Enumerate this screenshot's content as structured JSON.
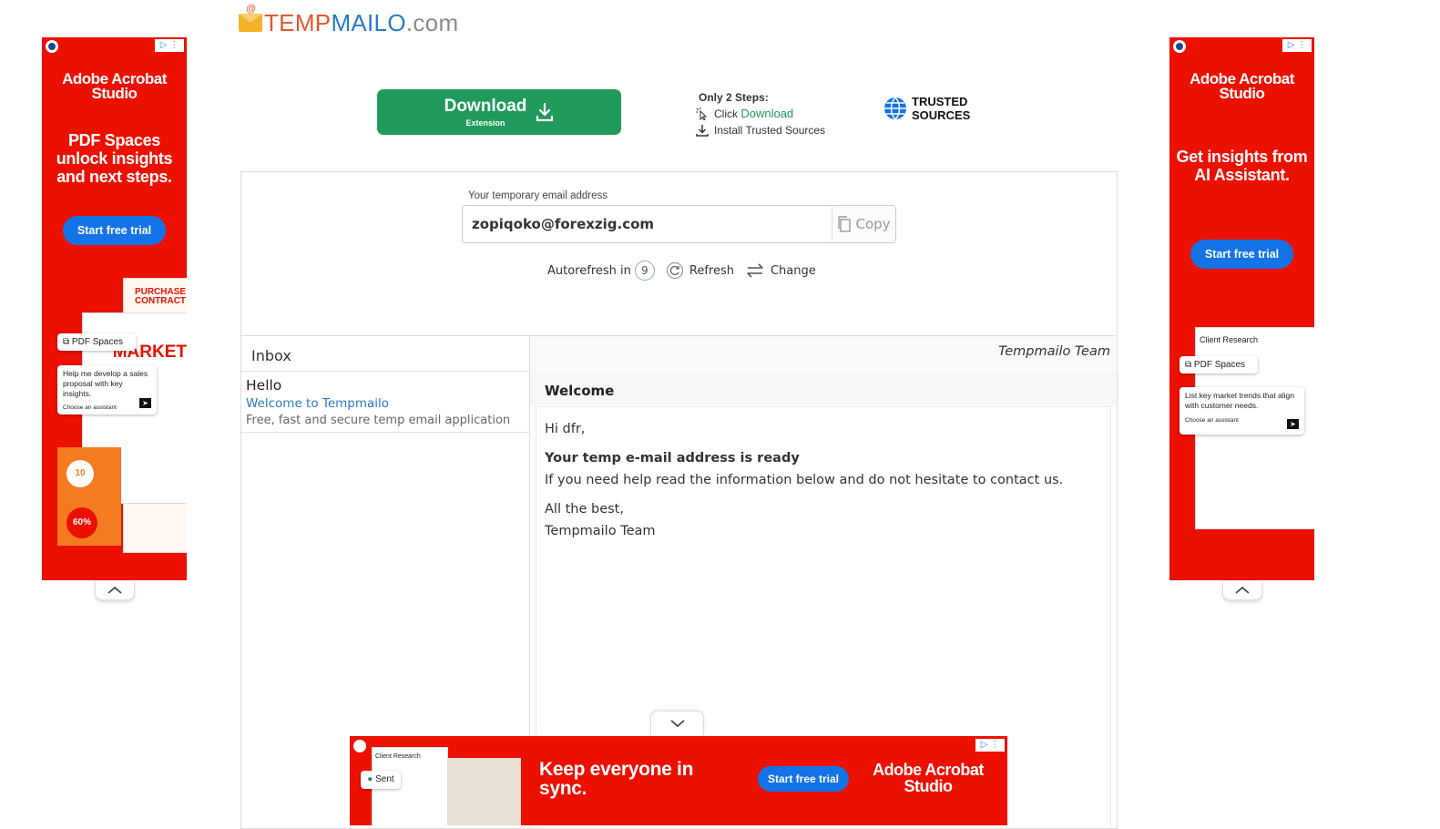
{
  "logo": {
    "part1": "TEMP",
    "part2": "MAILO",
    "part3": ".com"
  },
  "download": {
    "label": "Download",
    "sublabel": "Extension"
  },
  "steps": {
    "title": "Only 2 Steps:",
    "step1_prefix": "Click",
    "step1_link": "Download",
    "step2": "Install Trusted Sources"
  },
  "trusted": {
    "line1": "TRUSTED",
    "line2": "SOURCES"
  },
  "address": {
    "label": "Your temporary email address",
    "value": "zopiqoko@forexzig.com",
    "copy_label": "Copy"
  },
  "controls": {
    "autorefresh_label": "Autorefresh in",
    "countdown": "9",
    "refresh_label": "Refresh",
    "change_label": "Change"
  },
  "inbox": {
    "title": "Inbox",
    "messages": [
      {
        "from": "Hello",
        "subject": "Welcome to Tempmailo",
        "preview": "Free, fast and secure temp email application"
      }
    ]
  },
  "viewer": {
    "from": "Tempmailo Team",
    "subject": "Welcome",
    "greeting": "Hi dfr,",
    "heading": "Your temp e-mail address is ready",
    "line": "If you need help read the information below and do not hesitate to contact us.",
    "signoff": "All the best,",
    "signature": "Tempmailo Team"
  },
  "ad_left": {
    "brand": "Adobe Acrobat Studio",
    "headline": "PDF Spaces unlock insights and next steps.",
    "cta": "Start free trial",
    "chip": "PDF Spaces",
    "prompt": "Help me develop a sales proposal with key insights.",
    "assistant": "Choose an assistant",
    "doc_title": "PURCHASE CONTRACT",
    "doc_big": "MARKET",
    "stat1": "10",
    "stat2": "60%"
  },
  "ad_right": {
    "brand": "Adobe Acrobat Studio",
    "headline": "Get insights from AI Assistant.",
    "cta": "Start free trial",
    "chip": "PDF Spaces",
    "prompt": "List key market trends that align with customer needs.",
    "assistant": "Choose an assistant",
    "doc_title": "Client Research"
  },
  "ad_bottom": {
    "headline": "Keep everyone in sync.",
    "cta": "Start free trial",
    "brand": "Adobe Acrobat Studio",
    "chip": "Sent",
    "doc_title": "Client Research"
  },
  "icons": [
    "download-icon",
    "cursor-click-icon",
    "globe-icon",
    "copy-icon",
    "refresh-icon",
    "swap-icon",
    "chevron-up-icon",
    "chevron-down-icon",
    "adchoices-icon",
    "send-icon"
  ],
  "colors": {
    "download_green": "#1f9a5a",
    "link_blue": "#2a7ac0",
    "ad_red": "#eb1000",
    "ad_blue": "#1473e6",
    "logo_orange": "#e4572e"
  }
}
